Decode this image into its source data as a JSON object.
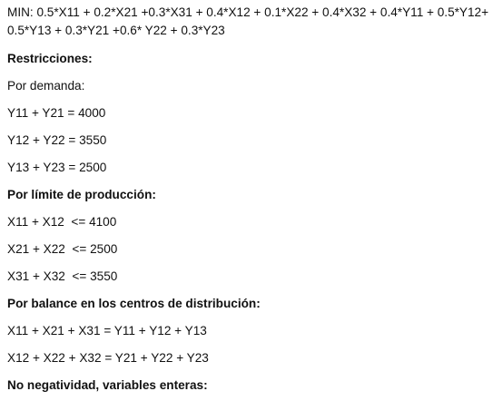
{
  "objective": {
    "line1": "MIN: 0.5*X11 + 0.2*X21 +0.3*X31 + 0.4*X12 + 0.1*X22 + 0.4*X32 + 0.4*Y11 + 0.5*Y12+",
    "line2": "0.5*Y13 + 0.3*Y21 +0.6* Y22 + 0.3*Y23"
  },
  "restricciones": {
    "heading": "Restricciones:",
    "por_demanda": {
      "label": "Por demanda:",
      "constraints": [
        "Y11 + Y21 = 4000",
        "Y12 + Y22 = 3550",
        "Y13 + Y23 = 2500"
      ]
    },
    "limite_produccion": {
      "heading": "Por límite de producción:",
      "constraints": [
        "X11 + X12  <= 4100",
        "X21 + X22  <= 2500",
        "X31 + X32  <= 3550"
      ]
    },
    "balance": {
      "heading": "Por balance en los centros de distribución:",
      "constraints": [
        "X11 + X21 + X31 = Y11 + Y12 + Y13",
        "X12 + X22 + X32 = Y21 + Y22 + Y23"
      ]
    },
    "no_negatividad": {
      "heading": "No negatividad, variables enteras:"
    }
  }
}
